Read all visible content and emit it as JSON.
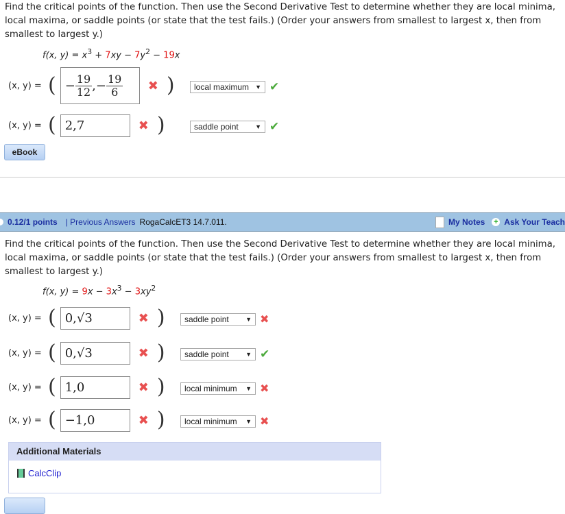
{
  "q1": {
    "text": "Find the critical points of the function. Then use the Second Derivative Test to determine whether they are local minima, local maxima, or saddle points (or state that the test fails.) (Order your answers from smallest to largest x, then from smallest to largest y.)",
    "fn": {
      "a": "f(x, y) = x",
      "e1": "3",
      "b": " + ",
      "c1": "7",
      "c": "xy − ",
      "c2": "7",
      "d": "y",
      "e2": "2",
      "f": " − ",
      "c3": "19",
      "g": "x"
    },
    "label": "(x, y) =",
    "answers": [
      {
        "n1": "19",
        "d1": "12",
        "n2": "19",
        "d2": "6",
        "select": "local maximum",
        "select_status": "correct"
      },
      {
        "value": "2,7",
        "select": "saddle point",
        "select_status": "correct"
      }
    ],
    "ebook": "eBook"
  },
  "bar": {
    "points": "0.12/1 points",
    "previous": "Previous Answers",
    "source": "RogaCalcET3 14.7.011.",
    "notes": "My Notes",
    "ask": "Ask Your Teach"
  },
  "q2": {
    "text": "Find the critical points of the function. Then use the Second Derivative Test to determine whether they are local minima, local maxima, or saddle points (or state that the test fails.) (Order your answers from smallest to largest x, then from smallest to largest y.)",
    "fn": {
      "a": "f(x, y) = ",
      "c1": "9",
      "b": "x − ",
      "c2": "3",
      "c": "x",
      "e1": "3",
      "d": " − ",
      "c3": "3",
      "f": "xy",
      "e2": "2"
    },
    "answers": [
      {
        "value": "0,√3",
        "select": "saddle point",
        "select_status": "incorrect"
      },
      {
        "value": "0,√3",
        "select": "saddle point",
        "select_status": "correct"
      },
      {
        "value": "1,0",
        "select": "local minimum",
        "select_status": "incorrect"
      },
      {
        "value": "−1,0",
        "select": "local minimum",
        "select_status": "incorrect"
      }
    ]
  },
  "materials": {
    "title": "Additional Materials",
    "link": "CalcClip"
  },
  "icons": {
    "correct": "check-icon",
    "incorrect": "x-icon"
  }
}
